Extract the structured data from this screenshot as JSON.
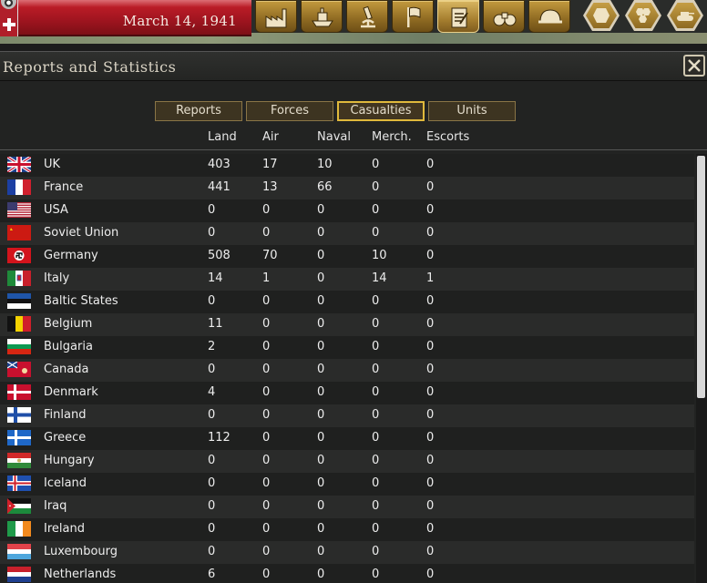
{
  "topbar": {
    "date": "March 14, 1941",
    "buttons": [
      {
        "icon": "factory-icon"
      },
      {
        "icon": "ship-icon"
      },
      {
        "icon": "microscope-icon"
      },
      {
        "icon": "flag-icon"
      },
      {
        "icon": "report-clipboard-icon",
        "active": true
      },
      {
        "icon": "binoculars-icon"
      },
      {
        "icon": "helmet-icon"
      }
    ],
    "hex_buttons": [
      {
        "icon": "hex-tile-icon"
      },
      {
        "icon": "hex-cluster-icon"
      },
      {
        "icon": "tank-icon"
      }
    ]
  },
  "window": {
    "title": "Reports and Statistics",
    "close_icon": "close-icon"
  },
  "tabs": [
    {
      "label": "Reports",
      "active": false
    },
    {
      "label": "Forces",
      "active": false
    },
    {
      "label": "Casualties",
      "active": true
    },
    {
      "label": "Units",
      "active": false
    }
  ],
  "columns": {
    "land": "Land",
    "air": "Air",
    "naval": "Naval",
    "merch": "Merch.",
    "escorts": "Escorts"
  },
  "rows": [
    {
      "country": "UK",
      "land": "403",
      "air": "17",
      "naval": "10",
      "merch": "0",
      "escorts": "0"
    },
    {
      "country": "France",
      "land": "441",
      "air": "13",
      "naval": "66",
      "merch": "0",
      "escorts": "0"
    },
    {
      "country": "USA",
      "land": "0",
      "air": "0",
      "naval": "0",
      "merch": "0",
      "escorts": "0"
    },
    {
      "country": "Soviet Union",
      "land": "0",
      "air": "0",
      "naval": "0",
      "merch": "0",
      "escorts": "0"
    },
    {
      "country": "Germany",
      "land": "508",
      "air": "70",
      "naval": "0",
      "merch": "10",
      "escorts": "0"
    },
    {
      "country": "Italy",
      "land": "14",
      "air": "1",
      "naval": "0",
      "merch": "14",
      "escorts": "1"
    },
    {
      "country": "Baltic States",
      "land": "0",
      "air": "0",
      "naval": "0",
      "merch": "0",
      "escorts": "0"
    },
    {
      "country": "Belgium",
      "land": "11",
      "air": "0",
      "naval": "0",
      "merch": "0",
      "escorts": "0"
    },
    {
      "country": "Bulgaria",
      "land": "2",
      "air": "0",
      "naval": "0",
      "merch": "0",
      "escorts": "0"
    },
    {
      "country": "Canada",
      "land": "0",
      "air": "0",
      "naval": "0",
      "merch": "0",
      "escorts": "0"
    },
    {
      "country": "Denmark",
      "land": "4",
      "air": "0",
      "naval": "0",
      "merch": "0",
      "escorts": "0"
    },
    {
      "country": "Finland",
      "land": "0",
      "air": "0",
      "naval": "0",
      "merch": "0",
      "escorts": "0"
    },
    {
      "country": "Greece",
      "land": "112",
      "air": "0",
      "naval": "0",
      "merch": "0",
      "escorts": "0"
    },
    {
      "country": "Hungary",
      "land": "0",
      "air": "0",
      "naval": "0",
      "merch": "0",
      "escorts": "0"
    },
    {
      "country": "Iceland",
      "land": "0",
      "air": "0",
      "naval": "0",
      "merch": "0",
      "escorts": "0"
    },
    {
      "country": "Iraq",
      "land": "0",
      "air": "0",
      "naval": "0",
      "merch": "0",
      "escorts": "0"
    },
    {
      "country": "Ireland",
      "land": "0",
      "air": "0",
      "naval": "0",
      "merch": "0",
      "escorts": "0"
    },
    {
      "country": "Luxembourg",
      "land": "0",
      "air": "0",
      "naval": "0",
      "merch": "0",
      "escorts": "0"
    },
    {
      "country": "Netherlands",
      "land": "6",
      "air": "0",
      "naval": "0",
      "merch": "0",
      "escorts": "0"
    }
  ],
  "colors": {
    "accent_gold": "#e0b93c",
    "title_red": "#b01e2a",
    "row_even": "#1f201f",
    "row_odd": "#2a2b2a"
  }
}
